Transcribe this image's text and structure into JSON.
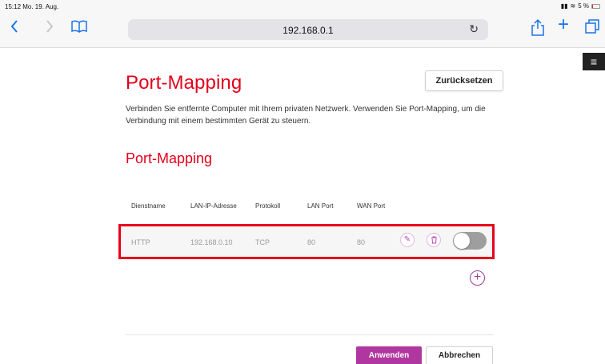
{
  "status_bar": {
    "time_date": "15:12  Mo. 19. Aug.",
    "battery": "5 %"
  },
  "browser": {
    "url": "192.168.0.1",
    "icons": {
      "back": "chevron-left-icon",
      "forward": "chevron-right-icon",
      "bookmarks": "book-icon",
      "reload": "reload-icon",
      "share": "share-icon",
      "new_tab": "plus-icon",
      "tabs": "tabs-icon"
    },
    "accent_color": "#1a73e8"
  },
  "page": {
    "title": "Port-Mapping",
    "reset_label": "Zurücksetzen",
    "description": "Verbinden Sie entfernte Computer mit Ihrem privaten Netzwerk. Verwenden Sie Port-Mapping, um die Verbindung mit einem bestimmten Gerät zu steuern.",
    "section_title": "Port-Mapping",
    "brand_color": "#e2001a"
  },
  "table": {
    "columns": [
      "Dienstname",
      "LAN-IP-Adresse",
      "Protokoll",
      "LAN Port",
      "WAN Port"
    ],
    "rows": [
      {
        "service": "HTTP",
        "lan_ip": "192.168.0.10",
        "protocol": "TCP",
        "lan_port": "80",
        "wan_port": "80",
        "enabled": false
      }
    ]
  },
  "actions": {
    "apply_label": "Anwenden",
    "cancel_label": "Abbrechen",
    "apply_color": "#b0379f"
  }
}
